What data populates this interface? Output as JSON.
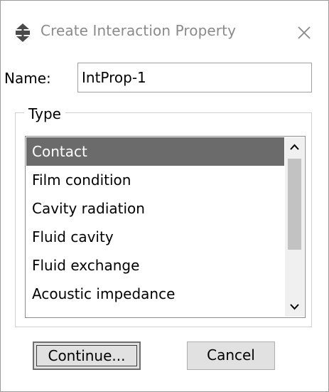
{
  "dialog": {
    "title": "Create Interaction Property",
    "title_icon": "interaction-property-icon",
    "close_icon": "close-icon"
  },
  "name_field": {
    "label": "Name:",
    "value": "IntProp-1"
  },
  "type_group": {
    "legend": "Type",
    "items": [
      {
        "label": "Contact",
        "selected": true
      },
      {
        "label": "Film condition",
        "selected": false
      },
      {
        "label": "Cavity radiation",
        "selected": false
      },
      {
        "label": "Fluid cavity",
        "selected": false
      },
      {
        "label": "Fluid exchange",
        "selected": false
      },
      {
        "label": "Acoustic impedance",
        "selected": false
      }
    ],
    "scroll_up_icon": "scroll-up-arrow-icon",
    "scroll_down_icon": "scroll-down-arrow-icon"
  },
  "buttons": {
    "continue_label": "Continue...",
    "cancel_label": "Cancel"
  },
  "colors": {
    "selected_bg": "#6b6b6b",
    "selected_fg": "#ffffff",
    "title_text": "#8a8a8a"
  }
}
